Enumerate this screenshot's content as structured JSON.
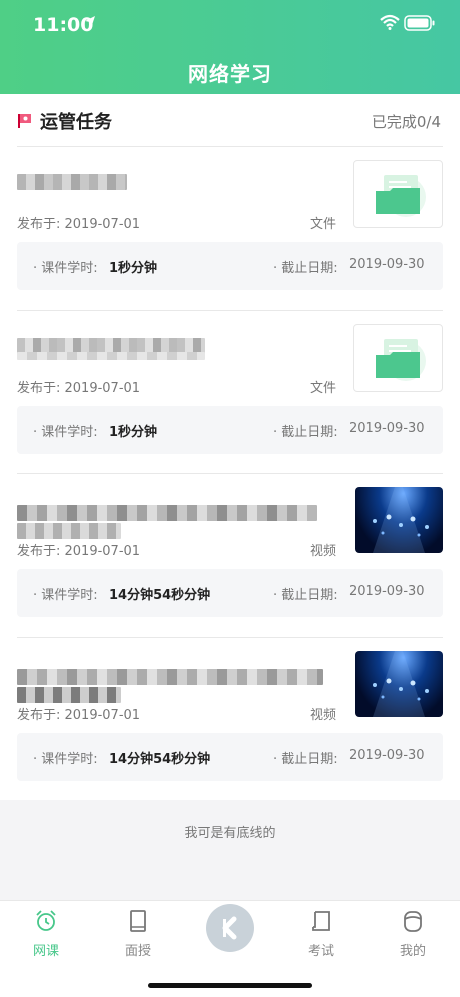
{
  "status_bar": {
    "time": "11:00"
  },
  "header": {
    "title": "网络学习"
  },
  "section": {
    "title": "运管任务",
    "progress": "已完成0/4"
  },
  "cards": [
    {
      "published": "发布于: 2019-07-01",
      "type": "文件",
      "thumb": "folder-icon",
      "hours_label": "· 课件学时:",
      "hours": "1秒分钟",
      "deadline_label": "· 截止日期:",
      "deadline": "2019-09-30"
    },
    {
      "published": "发布于: 2019-07-01",
      "type": "文件",
      "thumb": "folder-icon",
      "hours_label": "· 课件学时:",
      "hours": "1秒分钟",
      "deadline_label": "· 截止日期:",
      "deadline": "2019-09-30"
    },
    {
      "published": "发布于: 2019-07-01",
      "type": "视频",
      "thumb": "video-thumbnail",
      "hours_label": "· 课件学时:",
      "hours": "14分钟54秒分钟",
      "deadline_label": "· 截止日期:",
      "deadline": "2019-09-30"
    },
    {
      "published": "发布于: 2019-07-01",
      "type": "视频",
      "thumb": "video-thumbnail",
      "hours_label": "· 课件学时:",
      "hours": "14分钟54秒分钟",
      "deadline_label": "· 截止日期:",
      "deadline": "2019-09-30"
    }
  ],
  "footer": {
    "bottom_text": "我可是有底线的"
  },
  "tabs": [
    {
      "label": "网课",
      "icon": "alarm-clock-icon",
      "active": true
    },
    {
      "label": "面授",
      "icon": "tablet-icon",
      "active": false
    },
    {
      "label": "考试",
      "icon": "exam-paper-icon",
      "active": false
    },
    {
      "label": "我的",
      "icon": "user-icon",
      "active": false
    }
  ],
  "colors": {
    "accent": "#47c78a",
    "header_start": "#4fcf86",
    "header_end": "#46c7a3"
  }
}
